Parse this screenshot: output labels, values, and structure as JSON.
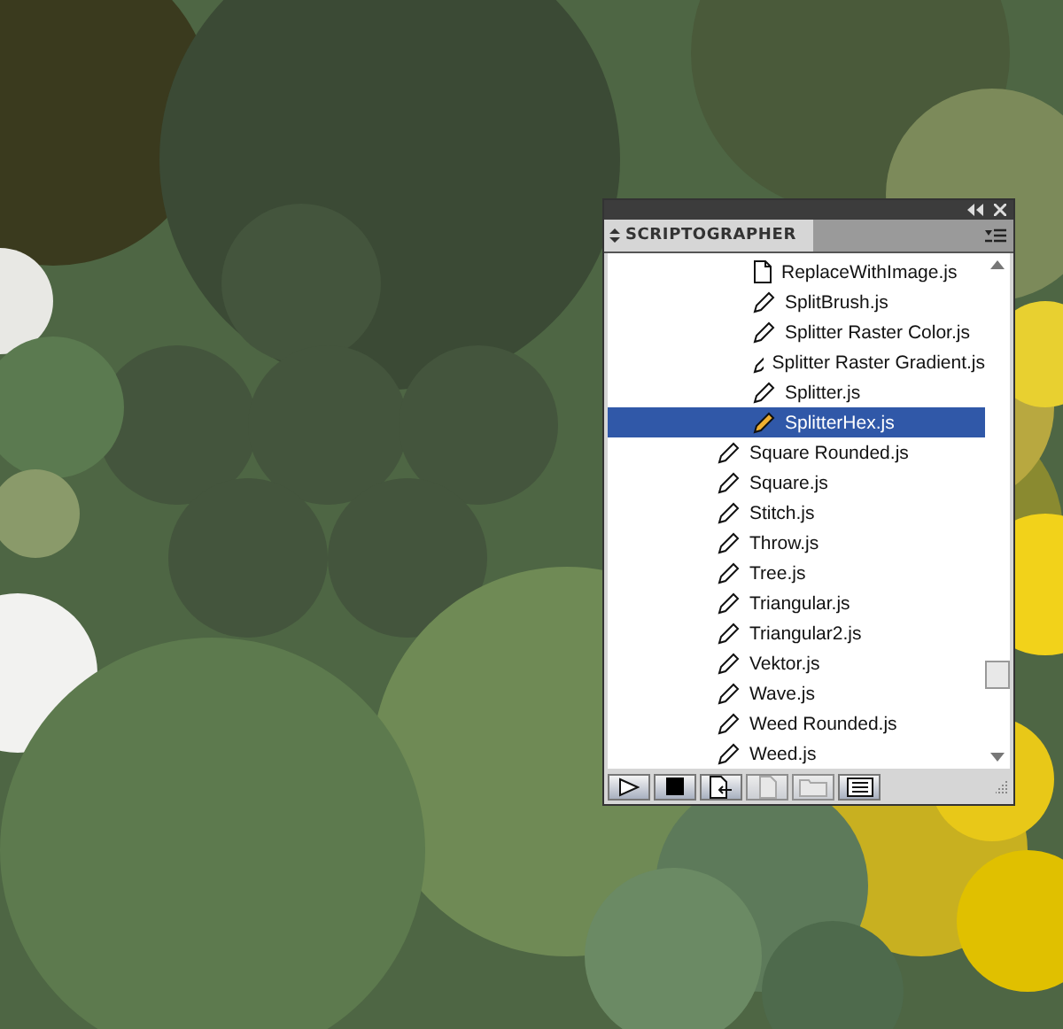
{
  "panel": {
    "title": "SCRIPTOGRAPHER",
    "scripts": [
      {
        "children": [
          {
            "label": "ReplaceWithImage.js",
            "kind": "document",
            "selected": false
          },
          {
            "label": "SplitBrush.js",
            "kind": "script",
            "selected": false
          },
          {
            "label": "Splitter Raster Color.js",
            "kind": "script",
            "selected": false
          },
          {
            "label": "Splitter Raster Gradient.js",
            "kind": "script",
            "selected": false
          },
          {
            "label": "Splitter.js",
            "kind": "script",
            "selected": false
          },
          {
            "label": "SplitterHex.js",
            "kind": "script",
            "selected": true
          }
        ]
      },
      {
        "label": "Square Rounded.js",
        "kind": "script",
        "selected": false
      },
      {
        "label": "Square.js",
        "kind": "script",
        "selected": false
      },
      {
        "label": "Stitch.js",
        "kind": "script",
        "selected": false
      },
      {
        "label": "Throw.js",
        "kind": "script",
        "selected": false
      },
      {
        "label": "Tree.js",
        "kind": "script",
        "selected": false
      },
      {
        "label": "Triangular.js",
        "kind": "script",
        "selected": false
      },
      {
        "label": "Triangular2.js",
        "kind": "script",
        "selected": false
      },
      {
        "label": "Vektor.js",
        "kind": "script",
        "selected": false
      },
      {
        "label": "Wave.js",
        "kind": "script",
        "selected": false
      },
      {
        "label": "Weed Rounded.js",
        "kind": "script",
        "selected": false
      },
      {
        "label": "Weed.js",
        "kind": "script",
        "selected": false
      }
    ],
    "toolbar": [
      {
        "kind": "run",
        "disabled": false
      },
      {
        "kind": "stop",
        "disabled": false
      },
      {
        "kind": "import",
        "disabled": false
      },
      {
        "kind": "new-file",
        "disabled": true
      },
      {
        "kind": "new-folder",
        "disabled": true
      },
      {
        "kind": "console",
        "disabled": false
      }
    ]
  }
}
